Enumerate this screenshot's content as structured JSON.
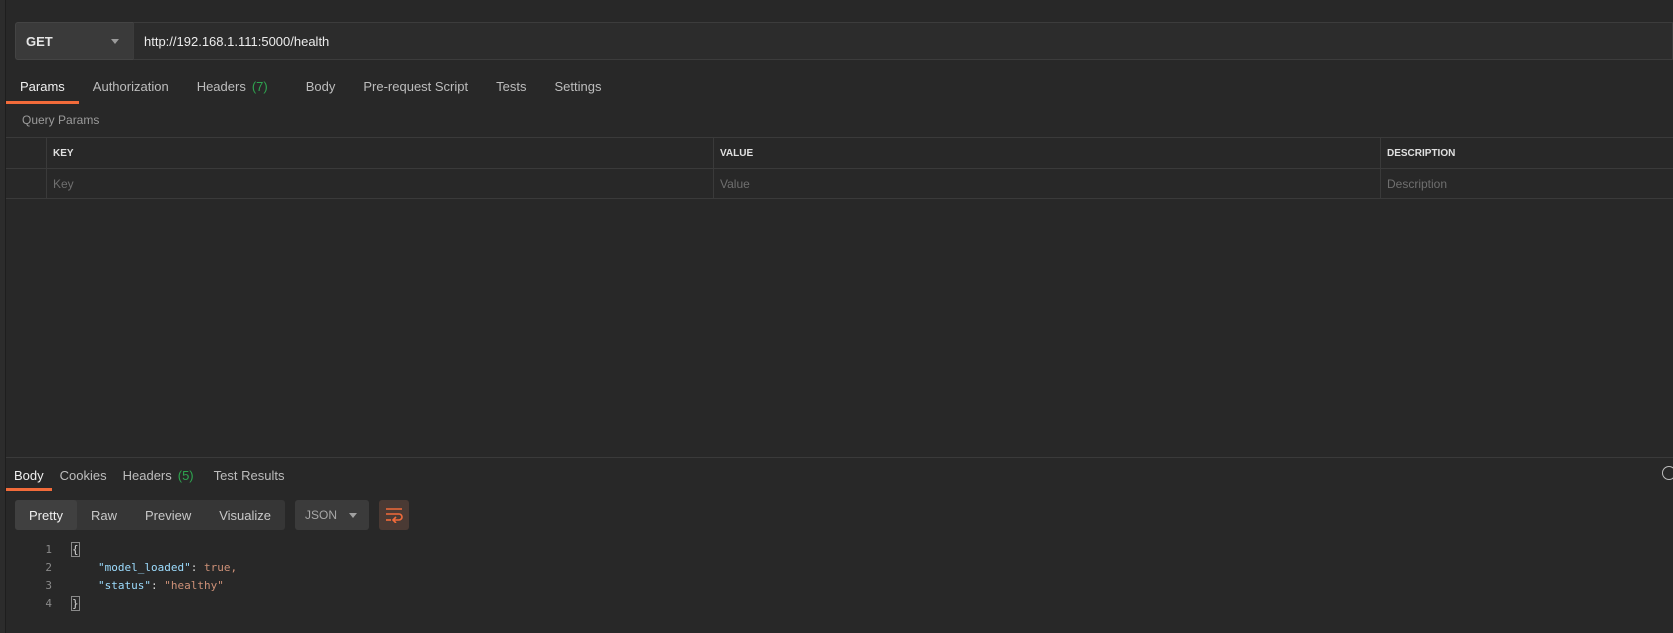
{
  "request": {
    "method": "GET",
    "url": "http://192.168.1.111:5000/health"
  },
  "request_tabs": [
    {
      "label": "Params",
      "active": true
    },
    {
      "label": "Authorization"
    },
    {
      "label": "Headers",
      "count": "(7)"
    },
    {
      "label": "Body"
    },
    {
      "label": "Pre-request Script"
    },
    {
      "label": "Tests"
    },
    {
      "label": "Settings"
    }
  ],
  "params": {
    "section_label": "Query Params",
    "headers": [
      "KEY",
      "VALUE",
      "DESCRIPTION"
    ],
    "placeholders": [
      "Key",
      "Value",
      "Description"
    ]
  },
  "response_tabs": [
    {
      "label": "Body",
      "active": true
    },
    {
      "label": "Cookies"
    },
    {
      "label": "Headers",
      "count": "(5)"
    },
    {
      "label": "Test Results"
    }
  ],
  "view_modes": [
    "Pretty",
    "Raw",
    "Preview",
    "Visualize"
  ],
  "active_view": "Pretty",
  "format": "JSON",
  "response_lines": [
    {
      "num": "1",
      "text": "{"
    },
    {
      "num": "2",
      "key": "\"model_loaded\"",
      "value": "true,"
    },
    {
      "num": "3",
      "key": "\"status\"",
      "value": "\"healthy\""
    },
    {
      "num": "4",
      "text": "}"
    }
  ],
  "colors": {
    "accent": "#f26b3a",
    "count": "#2ea44f",
    "json_key": "#9cdcfe",
    "json_value": "#ce9178"
  },
  "icons": [
    "chevron-down-icon",
    "wrap-lines-icon",
    "globe-icon"
  ]
}
